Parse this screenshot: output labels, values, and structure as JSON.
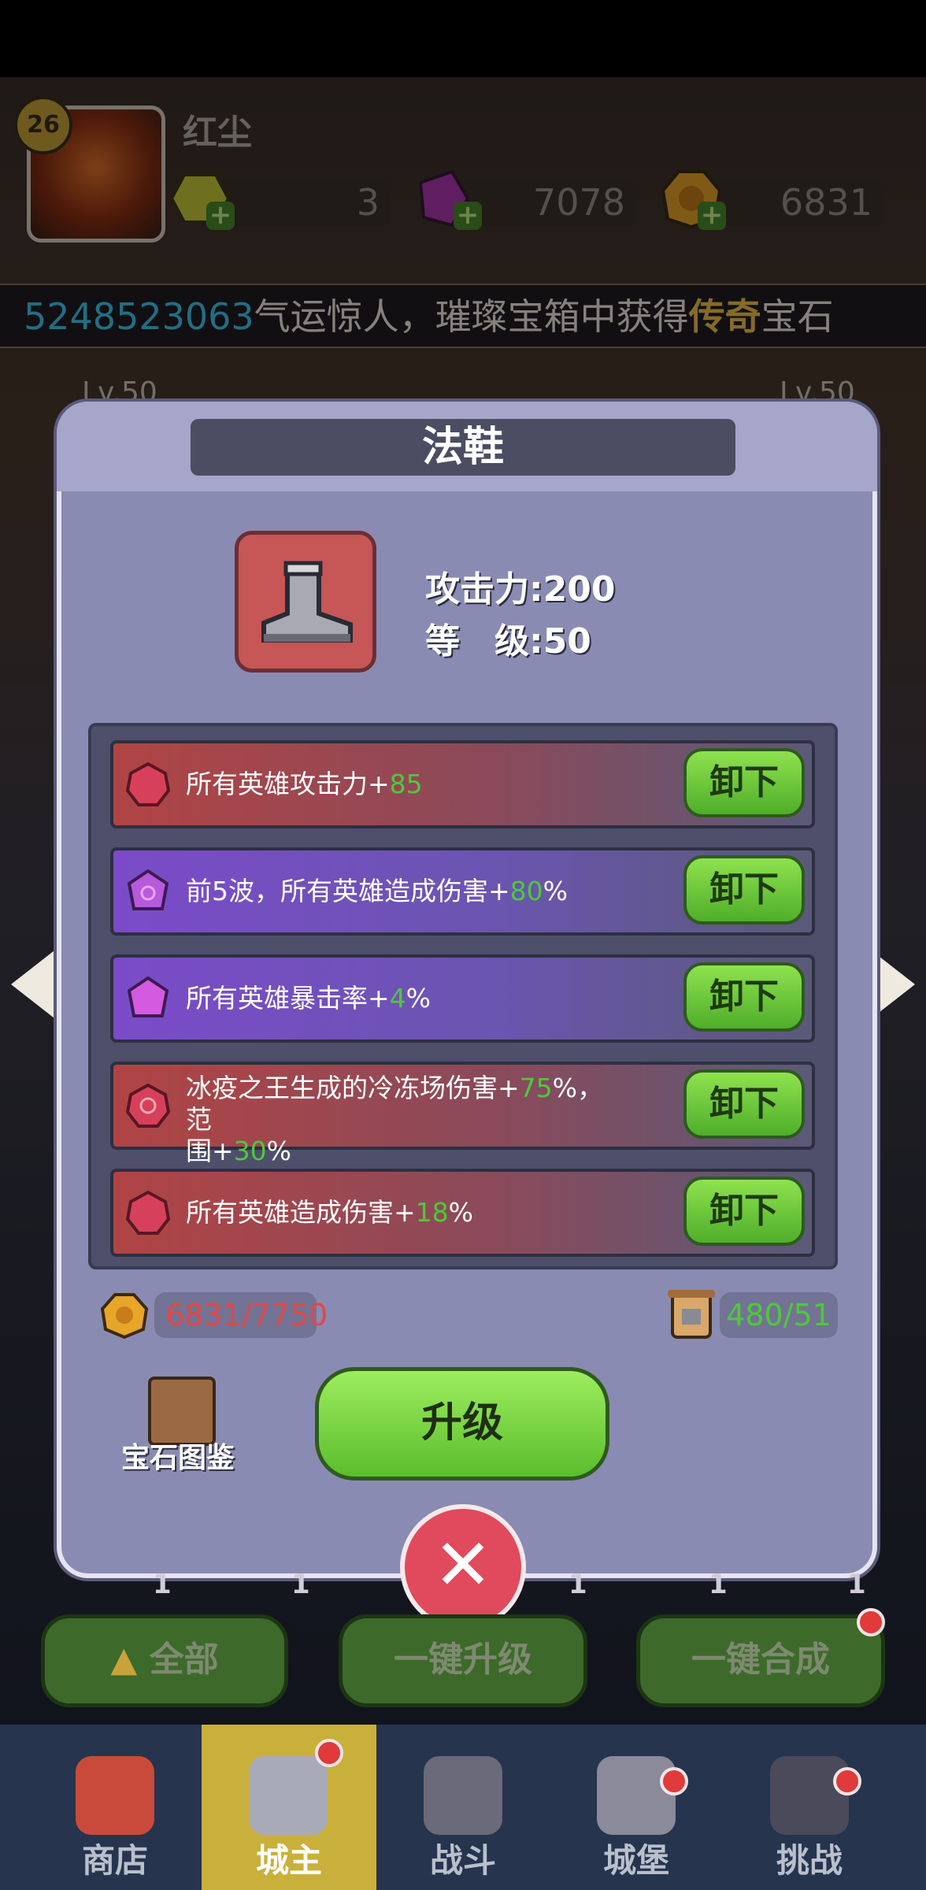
{
  "player": {
    "level": "26",
    "name": "红尘"
  },
  "resources": [
    {
      "name": "energy",
      "value": "3",
      "icon": "yellow-gem-icon"
    },
    {
      "name": "gems",
      "value": "7078",
      "icon": "purple-crystal-icon"
    },
    {
      "name": "gold",
      "value": "6831",
      "icon": "gold-coin-icon"
    }
  ],
  "ticker": {
    "number": "5248523063",
    "before": "气运惊人，璀璨宝箱中获得",
    "highlight": "传奇",
    "after": "宝石"
  },
  "bg_levels": {
    "left": "Lv.50",
    "right": "Lv.50"
  },
  "modal": {
    "title": "法鞋",
    "attack_label": "攻击力:",
    "attack_value": "200",
    "level_label": "等　级:",
    "level_value": "50",
    "gems": [
      {
        "color": "red",
        "text": "所有英雄攻击力+",
        "value": "85",
        "suffix": "",
        "button": "卸下"
      },
      {
        "color": "purple",
        "text": "前5波，所有英雄造成伤害+",
        "value": "80",
        "suffix": "%",
        "button": "卸下"
      },
      {
        "color": "purple",
        "text": "所有英雄暴击率+",
        "value": "4",
        "suffix": "%",
        "button": "卸下"
      },
      {
        "color": "red",
        "text": "冰疫之王生成的冷冻场伤害+",
        "value": "75",
        "suffix": "%，范",
        "text2": "围+",
        "value2": "30",
        "suffix2": "%",
        "button": "卸下"
      },
      {
        "color": "red",
        "text": "所有英雄造成伤害+",
        "value": "18",
        "suffix": "%",
        "button": "卸下"
      }
    ],
    "gold_cost": "6831/7750",
    "scroll_cost": "480/51",
    "book_label": "宝石图鉴",
    "upgrade_label": "升级"
  },
  "bottom_counts": [
    "1",
    "1",
    "1",
    "1",
    "1"
  ],
  "bottom_buttons": {
    "all": "全部",
    "upgrade_all": "一键升级",
    "merge_all": "一键合成"
  },
  "nav": [
    {
      "label": "商店",
      "badge": false
    },
    {
      "label": "城主",
      "badge": true,
      "active": true
    },
    {
      "label": "战斗",
      "badge": false
    },
    {
      "label": "城堡",
      "badge": true
    },
    {
      "label": "挑战",
      "badge": true
    }
  ],
  "colors": {
    "accent_green": "#4fc83a",
    "ticker_number": "#3ec9ee",
    "ticker_highlight": "#f3c44a",
    "gold_cost_red": "#e04848",
    "scroll_cost_green": "#4fc83a"
  }
}
